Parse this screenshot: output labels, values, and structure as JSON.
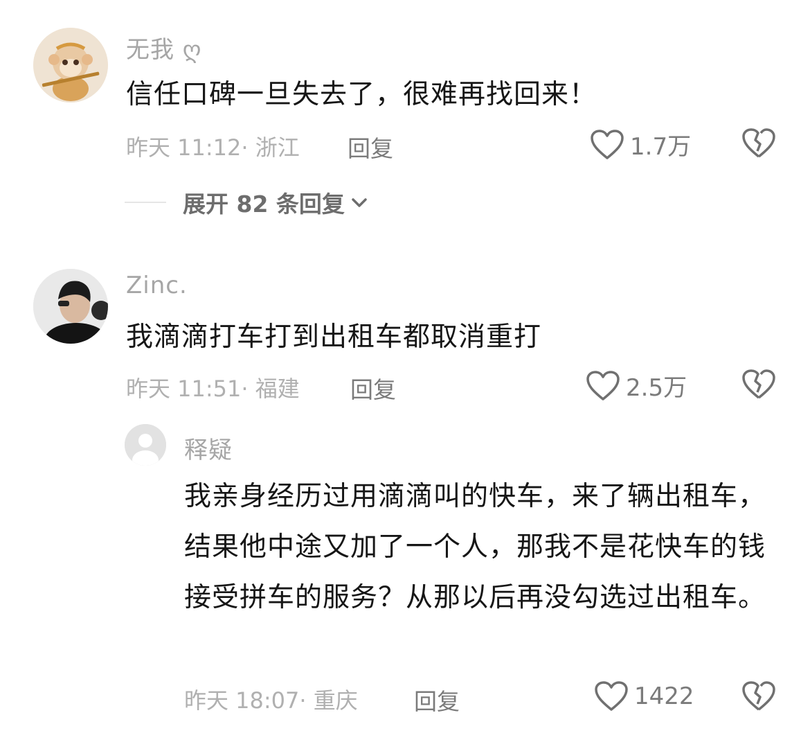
{
  "comments": [
    {
      "username": "无我 ღ",
      "text": "信任口碑一旦失去了，很难再找回来！",
      "meta": "昨天 11:12· 浙江",
      "reply_label": "回复",
      "likes": "1.7万",
      "expand_label": "展开 82 条回复"
    },
    {
      "username": "Zinc.",
      "text": "我滴滴打车打到出租车都取消重打",
      "meta": "昨天 11:51· 福建",
      "reply_label": "回复",
      "likes": "2.5万"
    }
  ],
  "reply": {
    "username": "释疑",
    "text": "我亲身经历过用滴滴叫的快车，来了辆出租车，结果他中途又加了一个人，那我不是花快车的钱接受拼车的服务？从那以后再没勾选过出租车。",
    "meta": "昨天 18:07· 重庆",
    "reply_label": "回复",
    "likes": "1422"
  },
  "colors": {
    "text": "#161616",
    "secondary": "#a6a6a6",
    "action": "#7b7b7b"
  },
  "icons": [
    "like-heart-icon",
    "dislike-broken-heart-icon",
    "chevron-down-icon",
    "default-avatar-icon"
  ]
}
